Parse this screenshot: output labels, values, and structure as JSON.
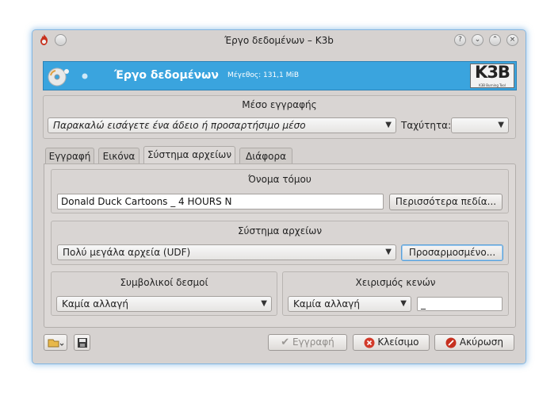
{
  "window": {
    "title": "Έργο δεδομένων – K3b",
    "titlebar_buttons": [
      "?",
      "⌄",
      "⌃",
      "×"
    ]
  },
  "banner": {
    "title": "Έργο δεδομένων",
    "size_label": "Μέγεθος: 131,1 MiB",
    "logo_text": "K3B",
    "logo_tagline": "K3B Burning Tool",
    "accent_color": "#3aa4de"
  },
  "media": {
    "group_title": "Μέσο εγγραφής",
    "selected": "Παρακαλώ εισάγετε ένα άδειο ή προσαρτήσιμο μέσο",
    "speed_label": "Ταχύτητα:",
    "speed_value": ""
  },
  "tabs": [
    {
      "label": "Εγγραφή"
    },
    {
      "label": "Εικόνα"
    },
    {
      "label": "Σύστημα αρχείων"
    },
    {
      "label": "Διάφορα"
    }
  ],
  "volume": {
    "group_title": "Όνομα τόμου",
    "value": "Donald Duck Cartoons _ 4 HOURS N",
    "more_fields_button": "Περισσότερα πεδία..."
  },
  "filesystem": {
    "group_title": "Σύστημα αρχείων",
    "selected": "Πολύ μεγάλα αρχεία (UDF)",
    "custom_button": "Προσαρμοσμένο..."
  },
  "symlinks": {
    "group_title": "Συμβολικοί δεσμοί",
    "selected": "Καμία αλλαγή"
  },
  "whitespace": {
    "group_title": "Χειρισμός κενών",
    "selected": "Καμία αλλαγή",
    "replace_value": "_"
  },
  "footer": {
    "burn_button": "Εγγραφή",
    "close_button": "Κλείσιμο",
    "cancel_button": "Ακύρωση"
  }
}
